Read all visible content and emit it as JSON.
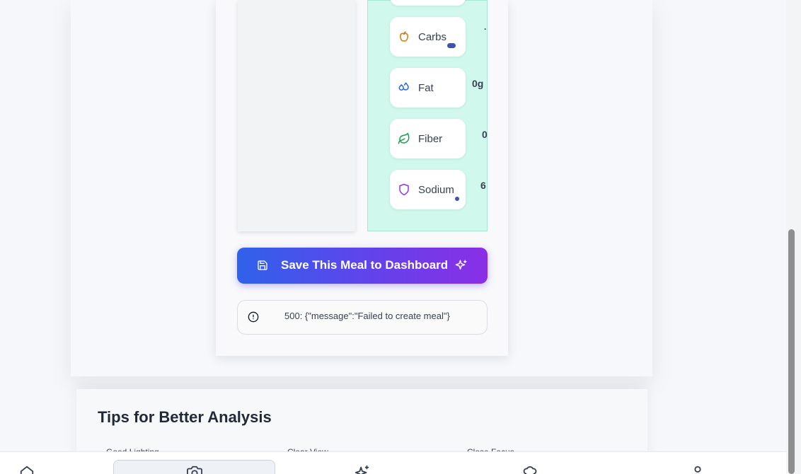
{
  "nutrients": [
    {
      "label": "Carbs",
      "icon": "apple-icon",
      "color": "#d97706",
      "value_cut": "·"
    },
    {
      "label": "Fat",
      "icon": "droplets-icon",
      "color": "#2563eb",
      "value_cut": "0g"
    },
    {
      "label": "Fiber",
      "icon": "leaf-icon",
      "color": "#16a34a",
      "value_cut": "0"
    },
    {
      "label": "Sodium",
      "icon": "shield-icon",
      "color": "#9333ea",
      "value_cut": "6"
    }
  ],
  "actions": {
    "save_label": "Save This Meal to Dashboard"
  },
  "error": {
    "message": "500: {\"message\":\"Failed to create meal\"}"
  },
  "tips": {
    "title": "Tips for Better Analysis",
    "items": [
      "Good Lighting",
      "Clear View",
      "Close Focus"
    ]
  },
  "colors": {
    "accent_start": "#2f62ea",
    "accent_end": "#8a2fe6",
    "mint_panel": "#d1f8ec"
  },
  "bottom_nav": [
    "home-icon",
    "camera-icon",
    "sparkles-icon",
    "chef-hat-icon",
    "user-icon"
  ]
}
